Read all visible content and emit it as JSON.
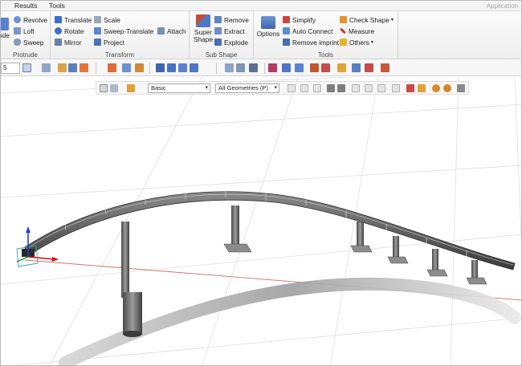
{
  "menu": {
    "items": [
      "Results",
      "Tools"
    ],
    "app_label": "Application"
  },
  "ribbon": {
    "protrude": {
      "label": "Protrude",
      "cut_label": "ude",
      "revolve": "Revolve",
      "loft": "Loft",
      "sweep": "Sweep"
    },
    "transform": {
      "label": "Transform",
      "translate": "Translate",
      "scale": "Scale",
      "rotate": "Rotate",
      "sweep_translate": "Sweep-Translate",
      "attach": "Attach",
      "mirror": "Mirror",
      "project": "Project"
    },
    "subshape": {
      "label": "Sub Shape",
      "super_shape": "Super Shape",
      "remove": "Remove",
      "extract": "Extract",
      "explode": "Explode"
    },
    "tools": {
      "label": "Tools",
      "options": "Options",
      "simplify": "Simplify",
      "auto_connect": "Auto Connect",
      "remove_imprint": "Remove imprint",
      "check_shape": "Check Shape",
      "measure": "Measure",
      "others": "Others"
    }
  },
  "toolbar": {
    "number_value": "5"
  },
  "view_toolbar": {
    "display_mode": "Basic",
    "geometry_filter": "All Geometries (P)"
  },
  "colors": {
    "ribbon_bg": "#f3f3f3",
    "selection_red": "#d01010",
    "axis_blue": "#1f3fd6",
    "axis_green": "#0ca020",
    "icon_blue": "#3a6fc4",
    "icon_orange": "#e8922a"
  },
  "icons": [
    "revolve-icon",
    "loft-icon",
    "sweep-icon",
    "translate-icon",
    "scale-icon",
    "rotate-icon",
    "sweep-translate-icon",
    "attach-icon",
    "mirror-icon",
    "project-icon",
    "super-shape-icon",
    "remove-icon",
    "extract-icon",
    "explode-icon",
    "options-icon",
    "simplify-icon",
    "auto-connect-icon",
    "remove-imprint-icon",
    "check-shape-icon",
    "measure-icon",
    "others-icon"
  ]
}
